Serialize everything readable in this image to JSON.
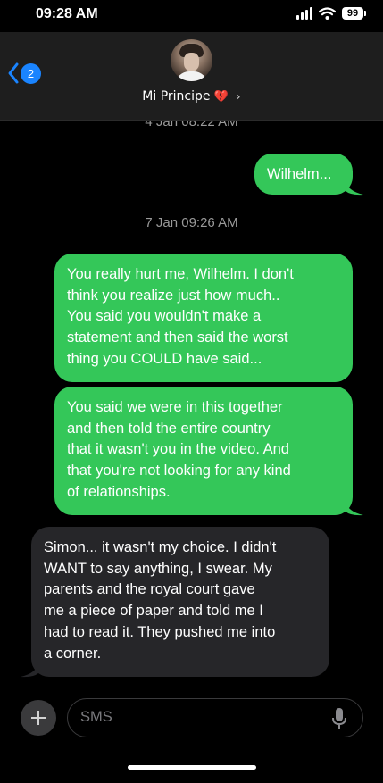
{
  "status_bar": {
    "time": "09:28 AM",
    "battery": "99",
    "icons": [
      "signal-icon",
      "wifi-icon",
      "battery-icon"
    ]
  },
  "header": {
    "back_badge": "2",
    "contact_name": "Mi Principe",
    "contact_emoji": "💔",
    "chevron": "›",
    "icons": [
      "back-chevron-icon",
      "avatar",
      "chevron-right-icon"
    ]
  },
  "thread": {
    "timestamps": [
      "4 Jan 08:22 AM",
      "7 Jan 09:26 AM"
    ],
    "messages": [
      {
        "direction": "outgoing",
        "text": "Wilhelm..."
      },
      {
        "direction": "outgoing",
        "lines": [
          "You really hurt me, Wilhelm. I don't",
          "think you realize just how much..",
          "You said you wouldn't make a",
          "statement and then said the worst",
          "thing you COULD have said..."
        ]
      },
      {
        "direction": "outgoing",
        "lines": [
          "You said we were in this together",
          "and then told the entire country",
          "that it wasn't you in the video. And",
          "that you're not looking for any kind",
          "of relationships."
        ]
      },
      {
        "direction": "incoming",
        "lines": [
          "Simon... it wasn't my choice. I didn't",
          "WANT to say anything, I swear. My",
          "parents and the royal court gave",
          "me a piece of paper and told me I",
          "had to read it. They pushed me into",
          "a corner."
        ]
      }
    ]
  },
  "composer": {
    "placeholder": "SMS",
    "icons": [
      "plus-icon",
      "microphone-icon"
    ]
  },
  "colors": {
    "outgoing_bubble": "#34c759",
    "incoming_bubble": "#262629",
    "badge": "#1a84ff",
    "header_bg": "#1e1e1e",
    "timestamp": "#9a9a9a"
  }
}
